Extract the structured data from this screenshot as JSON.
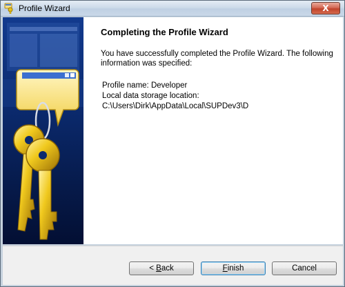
{
  "window": {
    "title": "Profile Wizard"
  },
  "titlebar": {
    "close_glyph": "X"
  },
  "content": {
    "heading": "Completing the Profile Wizard",
    "intro": "You have successfully completed the Profile Wizard. The following information was specified:",
    "profile_name_line": "Profile name:  Developer",
    "storage_label": "Local data storage location:",
    "storage_path": "C:\\Users\\Dirk\\AppData\\Local\\SUPDev3\\D"
  },
  "buttons": {
    "back_prefix": "< ",
    "back_mnemonic": "B",
    "back_rest": "ack",
    "finish_mnemonic": "F",
    "finish_rest": "inish",
    "cancel": "Cancel"
  },
  "colors": {
    "side_panel": "#0b2a6e",
    "close_button": "#c0432b",
    "key_gold": "#e8c21a"
  },
  "icons": [
    "wizard-keys-icon",
    "close-icon",
    "keys-illustration",
    "speech-bubble-window-icon"
  ]
}
